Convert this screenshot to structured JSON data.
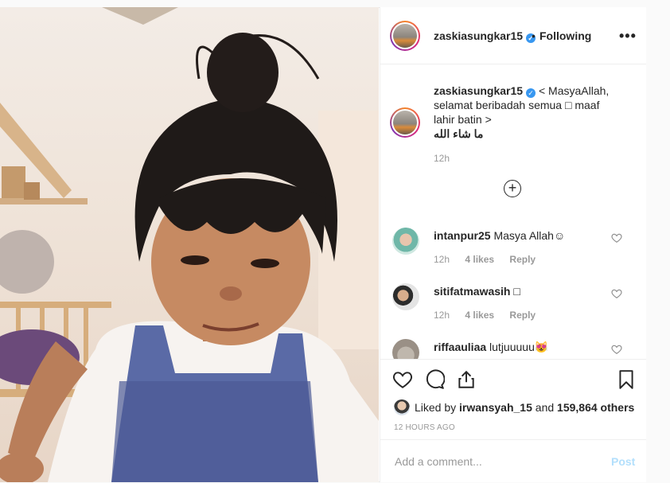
{
  "header": {
    "username": "zaskiasungkar15",
    "dot": "•",
    "follow_status": "Following",
    "more": "•••"
  },
  "caption": {
    "username": "zaskiasungkar15",
    "text": "< MasyaAllah, selamat beribadah semua □ maaf lahir batin >",
    "arabic": "ما شاء الله",
    "time": "12h"
  },
  "load_more": "+",
  "comments": [
    {
      "username": "intanpur25",
      "text": "Masya Allah☺",
      "time": "12h",
      "likes": "4 likes",
      "reply": "Reply"
    },
    {
      "username": "sitifatmawasih",
      "text": "□",
      "time": "12h",
      "likes": "4 likes",
      "reply": "Reply"
    },
    {
      "username": "riffaauliaa",
      "text": "lutjuuuuu😻",
      "time": "",
      "likes": "",
      "reply": ""
    }
  ],
  "likes": {
    "prefix": "Liked by",
    "user": "irwansyah_15",
    "middle": "and",
    "count": "159,864 others"
  },
  "posted_ago": "12 HOURS AGO",
  "comment_input": {
    "placeholder": "Add a comment...",
    "post_label": "Post"
  },
  "colors": {
    "accent": "#3897f0",
    "post_disabled": "#b2dffc",
    "muted": "#999999"
  }
}
